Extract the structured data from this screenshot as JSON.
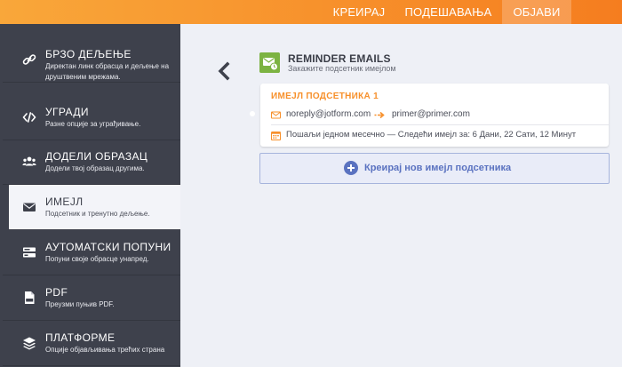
{
  "topnav": {
    "tabs": [
      {
        "label": "КРЕИРАЈ"
      },
      {
        "label": "ПОДЕШАВАЊА"
      },
      {
        "label": "ОБЈАВИ"
      }
    ]
  },
  "sidebar": {
    "items": [
      {
        "title": "БРЗО ДЕЉЕЊЕ",
        "desc": "Директан линк обрасца и дељење на друштвеним мрежама.",
        "icon": "link-icon"
      },
      {
        "title": "УГРАДИ",
        "desc": "Разне опције за уграђивање.",
        "icon": "code-icon"
      },
      {
        "title": "ДОДЕЛИ ОБРАЗАЦ",
        "desc": "Додели твој образац другима.",
        "icon": "users-icon"
      },
      {
        "title": "ИМЕЈЛ",
        "desc": "Подсетник и тренутно дељење.",
        "icon": "envelope-icon"
      },
      {
        "title": "АУТОМАТСКИ ПОПУНИ",
        "desc": "Попуни своје обрасце унапред.",
        "icon": "prefill-icon"
      },
      {
        "title": "PDF",
        "desc": "Преузми пуњив PDF.",
        "icon": "pdf-icon"
      },
      {
        "title": "ПЛАТФОРМЕ",
        "desc": "Опције објављивања трећих страна",
        "icon": "layers-icon"
      }
    ]
  },
  "main": {
    "section_title": "REMINDER EMAILS",
    "section_subtitle": "Закажите подсетник имејлом",
    "card": {
      "title": "ИМЕЈЛ ПОДСЕТНИКА 1",
      "from": "noreply@jotform.com",
      "to": "primer@primer.com",
      "schedule": "Пошаљи једном месечно — Следећи имејл за: 6 Дани, 22 Сати, 12 Минут"
    },
    "add_button": "Креирај нов имејл подсетника"
  },
  "colors": {
    "accent": "#f7902b",
    "sidebar_bg": "#3e414c",
    "link_blue": "#5a72c0",
    "section_icon_green": "#7cb342"
  }
}
